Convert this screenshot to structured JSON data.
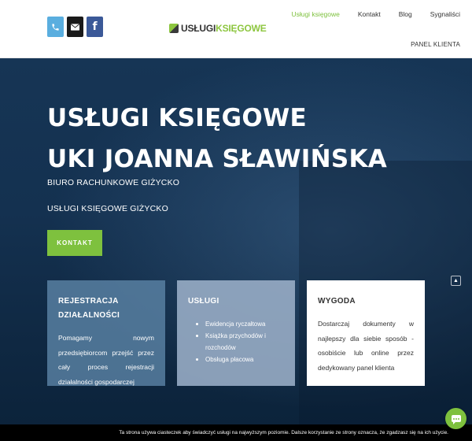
{
  "header": {
    "social": {
      "phone_icon": "phone-icon",
      "mail_icon": "mail-icon",
      "facebook_label": "f"
    },
    "logo": {
      "part1": "USŁUGI",
      "part2": "KSIĘGOWE"
    },
    "nav": [
      {
        "label": "Usługi księgowe",
        "active": true
      },
      {
        "label": "Kontakt"
      },
      {
        "label": "Blog"
      },
      {
        "label": "Sygnaliści"
      }
    ],
    "panel_link": "PANEL KLIENTA"
  },
  "hero": {
    "title_line1": "USŁUGI KSIĘGOWE",
    "title_line2": "UKI JOANNA SŁAWIŃSKA",
    "subtitle1": "BIURO RACHUNKOWE GIŻYCKO",
    "subtitle2": "USŁUGI KSIĘGOWE GIŻYCKO",
    "cta_label": "KONTAKT"
  },
  "cards": [
    {
      "title_line1": "REJESTRACJA",
      "title_line2": "DZIAŁALNOŚCI",
      "body": "Pomagamy nowym przedsiębiorcom przejść przez cały proces rejestracji działalności gospodarczej"
    },
    {
      "title": "USŁUGI",
      "items": [
        "Ewidencja ryczałtowa",
        "Książka przychodów i rozchodów",
        "Obsługa płacowa"
      ]
    },
    {
      "title": "WYGODA",
      "body": "Dostarczaj dokumenty w najlepszy dla siebie sposób - osobiście lub online przez dedykowany panel klienta"
    }
  ],
  "cookie_text": "Ta strona używa ciasteczek aby świadczyć usługi na najwyższym poziomie. Dalsze korzystanie ze strony oznacza, że zgadzasz się na ich użycie.",
  "colors": {
    "accent": "#7ec13e",
    "hero_bg": "#143150",
    "phone": "#5aaedf",
    "facebook": "#3b5998"
  }
}
